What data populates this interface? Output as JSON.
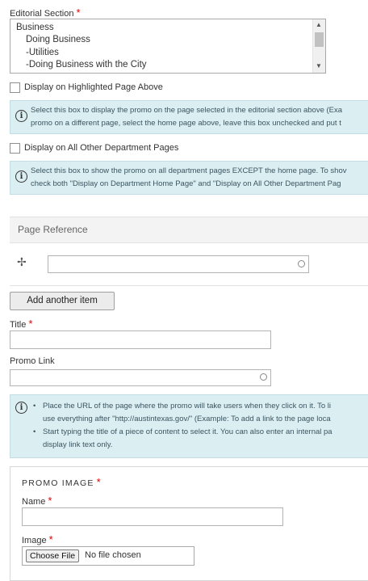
{
  "editorial_section": {
    "label": "Editorial Section",
    "required_mark": "*",
    "options": [
      "Business",
      "Doing Business",
      "-Utilities",
      "-Doing Business with the City"
    ]
  },
  "highlighted": {
    "label": "Display on Highlighted Page Above",
    "help_line1": "Select this box to display the promo on the page selected in the editorial section above (Exa",
    "help_line2": "promo on a different page, select the home page above, leave this box unchecked and put t"
  },
  "all_other": {
    "label": "Display on All Other Department Pages",
    "help_line1": "Select this box to show the promo on all department pages EXCEPT the home page. To shov",
    "help_line2": "check both \"Display on Department Home Page\" and \"Display on All Other Department Pag"
  },
  "page_reference": {
    "heading": "Page Reference",
    "value": ""
  },
  "add_another_label": "Add another item",
  "title_field": {
    "label": "Title",
    "required_mark": "*",
    "value": ""
  },
  "promo_link": {
    "label": "Promo Link",
    "value": "",
    "help_b1_l1": "Place the URL of the page where the promo will take users when they click on it. To li",
    "help_b1_l2": "use everything after \"http://austintexas.gov/\" (Example: To add a link to the page loca",
    "help_b2_l1": "Start typing the title of a piece of content to select it. You can also enter an internal pa",
    "help_b2_l2": "display link text only."
  },
  "promo_image": {
    "heading": "PROMO IMAGE",
    "required_mark": "*",
    "name_label": "Name",
    "name_value": "",
    "image_label": "Image",
    "choose_label": "Choose File",
    "no_file": "No file chosen"
  },
  "icons": {
    "info": "info-icon",
    "drag": "drag-handle-icon",
    "autocomplete": "autocomplete-throbber-icon"
  }
}
